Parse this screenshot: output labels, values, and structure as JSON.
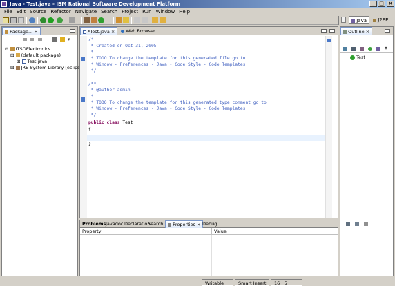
{
  "window": {
    "title": "Java - Test.java - IBM Rational Software Development Platform",
    "min": "_",
    "max": "□",
    "close": "×"
  },
  "menu": [
    "File",
    "Edit",
    "Source",
    "Refactor",
    "Navigate",
    "Search",
    "Project",
    "Run",
    "Window",
    "Help"
  ],
  "perspectives": {
    "java": "Java",
    "j2ee": "J2EE"
  },
  "package_explorer": {
    "tab": "Package...",
    "close": "×",
    "tree": [
      {
        "label": "ITSOElectronics",
        "expander": "⊟"
      },
      {
        "label": "(default package)",
        "expander": "⊟"
      },
      {
        "label": "Test.java",
        "expander": "⊞"
      },
      {
        "label": "JRE System Library [eclipse]",
        "expander": "⊞"
      }
    ]
  },
  "editor": {
    "tabs": [
      {
        "label": "*Test.java",
        "close": "×"
      },
      {
        "label": "Web Browser"
      }
    ],
    "lines": [
      {
        "text": "/*",
        "style": "comment"
      },
      {
        "text": " * Created on Oct 31, 2005",
        "style": "comment"
      },
      {
        "text": " *",
        "style": "comment"
      },
      {
        "text": " * TODO To change the template for this generated file go to",
        "style": "comment"
      },
      {
        "text": " * Window - Preferences - Java - Code Style - Code Templates",
        "style": "comment"
      },
      {
        "text": " */",
        "style": "comment"
      },
      {
        "text": "",
        "style": "plain"
      },
      {
        "text": "/**",
        "style": "comment"
      },
      {
        "text": " * @author admin",
        "style": "comment"
      },
      {
        "text": " *",
        "style": "comment"
      },
      {
        "text": " * TODO To change the template for this generated type comment go to",
        "style": "comment"
      },
      {
        "text": " * Window - Preferences - Java - Code Style - Code Templates",
        "style": "comment"
      },
      {
        "text": " */",
        "style": "comment"
      },
      {
        "text": "public class Test",
        "style": "class"
      },
      {
        "text": "{",
        "style": "plain"
      },
      {
        "text": "",
        "style": "plain"
      },
      {
        "text": "}",
        "style": "plain"
      }
    ],
    "class_kw1": "public",
    "class_kw2": "class",
    "class_name": "Test"
  },
  "outline": {
    "tab": "Outline",
    "close": "×",
    "item": "Test"
  },
  "bottom": {
    "tabs": [
      "Problems",
      "Javadoc",
      "Declaration",
      "Search",
      "Properties",
      "Debug"
    ],
    "properties_close": "×",
    "columns": [
      "Property",
      "Value"
    ]
  },
  "status": {
    "mode": "Writable",
    "insert": "Smart Insert",
    "position": "16 : 5"
  }
}
